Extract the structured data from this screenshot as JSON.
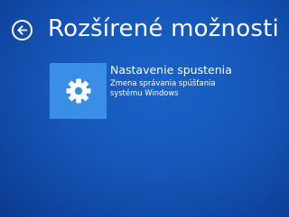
{
  "header": {
    "back_icon": "back-arrow-icon",
    "title": "Rozšírené možnosti"
  },
  "options": [
    {
      "icon": "gear-icon",
      "title": "Nastavenie spustenia",
      "description": "Zmena správania spúšťania systému Windows"
    }
  ],
  "colors": {
    "background": "#1557b8",
    "tile_icon_bg": "#3a8ee6",
    "text": "#ffffff"
  }
}
